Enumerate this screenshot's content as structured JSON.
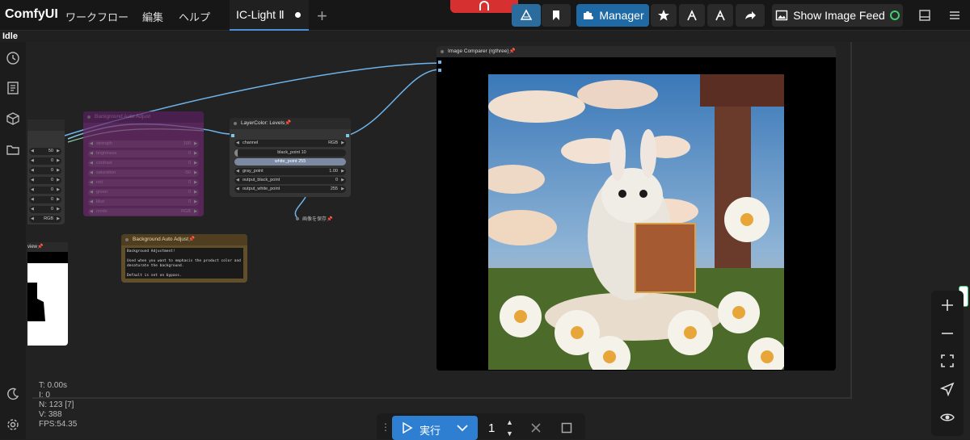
{
  "app": {
    "title": "ComfyUI"
  },
  "menu": {
    "workflow": "ワークフロー",
    "edit": "編集",
    "help": "ヘルプ"
  },
  "tab": {
    "label": "IC-Light Ⅱ"
  },
  "toolbar": {
    "manager_label": "Manager",
    "feed_label": "Show Image Feed"
  },
  "status": {
    "queue": "Idle"
  },
  "stats": {
    "t": "T: 0.00s",
    "i": "I: 0",
    "n": "N: 123 [7]",
    "v": "V: 388",
    "fps": "FPS:54.35"
  },
  "nodes": {
    "left_partial": {
      "rows": [
        "50",
        "0",
        "0",
        "0",
        "0",
        "0",
        "0",
        "RGB"
      ]
    },
    "preview_partial": {
      "title_tail": "view"
    },
    "bg_adjust_purple": {
      "title": "Background Auto Adjust",
      "rows": [
        {
          "label": "strength",
          "value": "100"
        },
        {
          "label": "brightness",
          "value": "0"
        },
        {
          "label": "contrast",
          "value": "0"
        },
        {
          "label": "saturation",
          "value": "-50"
        },
        {
          "label": "red",
          "value": "0"
        },
        {
          "label": "green",
          "value": "0"
        },
        {
          "label": "blue",
          "value": "0"
        },
        {
          "label": "mode",
          "value": "RGB"
        }
      ]
    },
    "levels": {
      "title": "LayerColor: Levels",
      "channel_label": "channel",
      "channel_value": "RGB",
      "black_point": "black_point  10",
      "white_point": "white_point  255",
      "gray_label": "gray_point",
      "gray_value": "1.00",
      "out_black_label": "output_black_point",
      "out_black_value": "0",
      "out_white_label": "output_white_point",
      "out_white_value": "255"
    },
    "save_image": {
      "title": "画像を保存"
    },
    "note": {
      "title": "Background Auto Adjust",
      "text": "Background Adjustment!\n\nUsed when you want to emphasis the product color and desaturate the background.\n\nDefault is set on bypass."
    },
    "image_comparer": {
      "title": "Image Comparer (rgthree)"
    }
  },
  "runbar": {
    "run_label": "実行",
    "count": "1"
  },
  "colors": {
    "accent": "#2e7fd1",
    "purple_node": "#6d2a6d",
    "note_node": "#614f2a",
    "link_blue": "#6fb3e8"
  }
}
